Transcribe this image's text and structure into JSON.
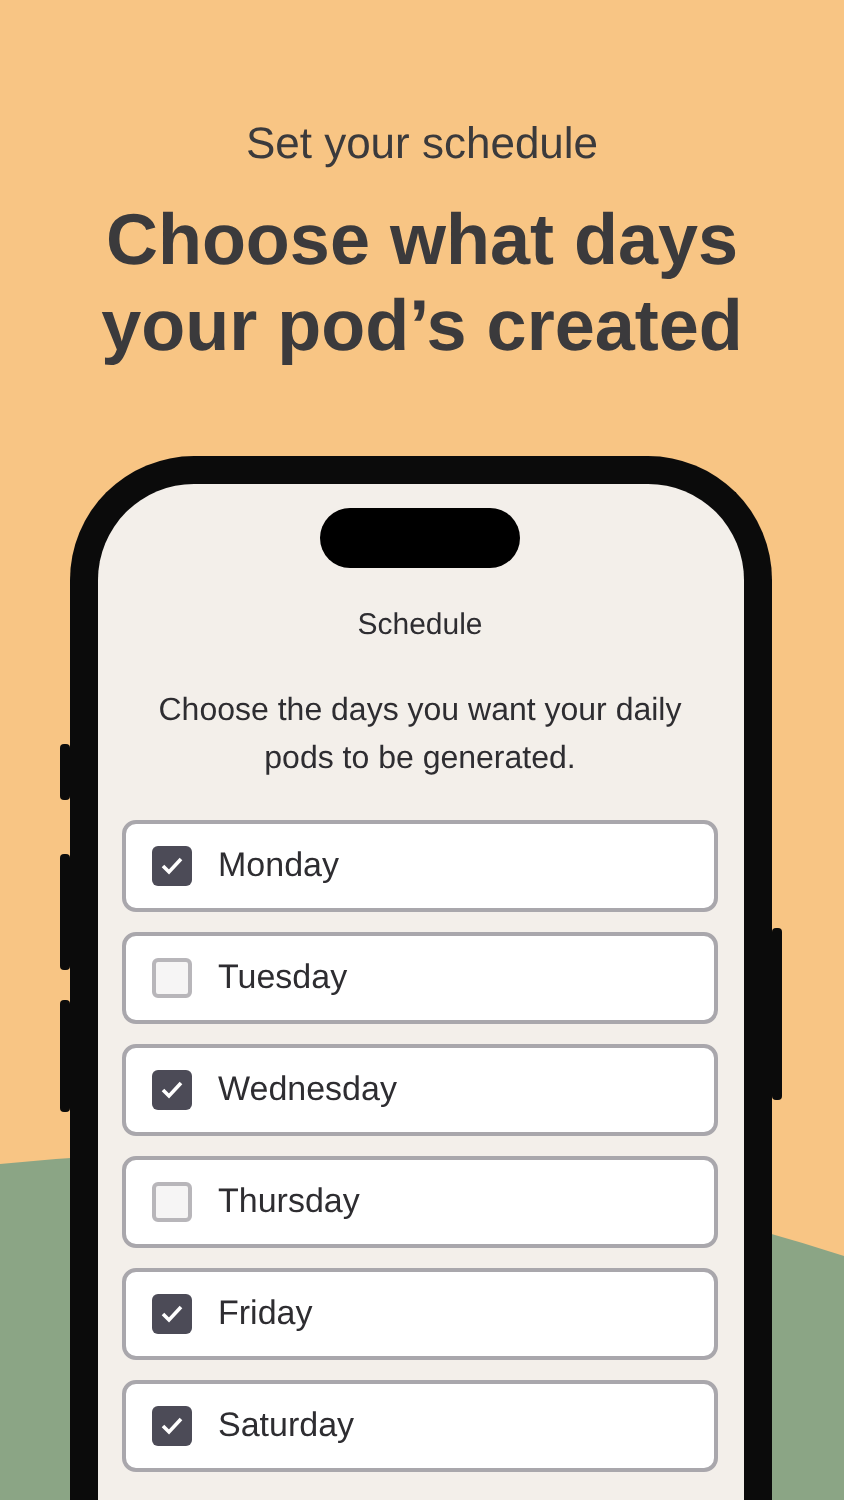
{
  "header": {
    "subtitle": "Set your schedule",
    "title": "Choose what days your pod’s created"
  },
  "screen": {
    "title": "Schedule",
    "description": "Choose the days you want your daily pods to be generated.",
    "days": [
      {
        "label": "Monday",
        "checked": true
      },
      {
        "label": "Tuesday",
        "checked": false
      },
      {
        "label": "Wednesday",
        "checked": true
      },
      {
        "label": "Thursday",
        "checked": false
      },
      {
        "label": "Friday",
        "checked": true
      },
      {
        "label": "Saturday",
        "checked": true
      }
    ]
  }
}
